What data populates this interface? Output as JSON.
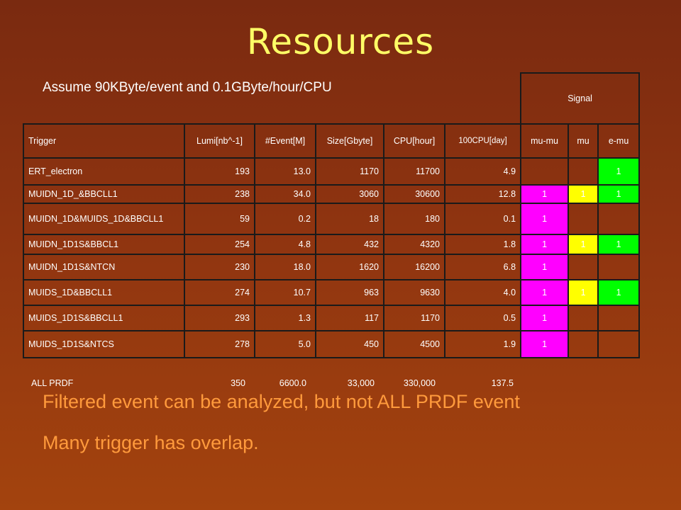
{
  "slide": {
    "title": "Resources",
    "assumption": "Assume 90KByte/event and 0.1GByte/hour/CPU",
    "notes": [
      "Filtered event can be analyzed,  but not ALL PRDF event",
      "Many trigger has overlap."
    ]
  },
  "table": {
    "signal_group_label": "Signal",
    "headers": [
      "Trigger",
      "Lumi[nb^-1]",
      "#Event[M]",
      "Size[Gbyte]",
      "CPU[hour]",
      "100CPU[day]",
      "mu-mu",
      "mu",
      "e-mu"
    ],
    "rows": [
      {
        "trigger": "ERT_electron",
        "lumi": "193",
        "events": "13.0",
        "size": "1170",
        "cpu": "11700",
        "cpu100": "4.9",
        "mumu": "",
        "mu": "",
        "emu": "1"
      },
      {
        "trigger": "MUIDN_1D_&BBCLL1",
        "lumi": "238",
        "events": "34.0",
        "size": "3060",
        "cpu": "30600",
        "cpu100": "12.8",
        "mumu": "1",
        "mu": "1",
        "emu": "1"
      },
      {
        "trigger": "MUIDN_1D&MUIDS_1D&BBCLL1",
        "lumi": "59",
        "events": "0.2",
        "size": "18",
        "cpu": "180",
        "cpu100": "0.1",
        "mumu": "1",
        "mu": "",
        "emu": ""
      },
      {
        "trigger": "MUIDN_1D1S&BBCL1",
        "lumi": "254",
        "events": "4.8",
        "size": "432",
        "cpu": "4320",
        "cpu100": "1.8",
        "mumu": "1",
        "mu": "1",
        "emu": "1"
      },
      {
        "trigger": "MUIDN_1D1S&NTCN",
        "lumi": "230",
        "events": "18.0",
        "size": "1620",
        "cpu": "16200",
        "cpu100": "6.8",
        "mumu": "1",
        "mu": "",
        "emu": ""
      },
      {
        "trigger": "MUIDS_1D&BBCLL1",
        "lumi": "274",
        "events": "10.7",
        "size": "963",
        "cpu": "9630",
        "cpu100": "4.0",
        "mumu": "1",
        "mu": "1",
        "emu": "1"
      },
      {
        "trigger": "MUIDS_1D1S&BBCLL1",
        "lumi": "293",
        "events": "1.3",
        "size": "117",
        "cpu": "1170",
        "cpu100": "0.5",
        "mumu": "1",
        "mu": "",
        "emu": ""
      },
      {
        "trigger": "MUIDS_1D1S&NTCS",
        "lumi": "278",
        "events": "5.0",
        "size": "450",
        "cpu": "4500",
        "cpu100": "1.9",
        "mumu": "1",
        "mu": "",
        "emu": ""
      }
    ],
    "total": {
      "trigger": "ALL PRDF",
      "lumi": "350",
      "events": "6600.0",
      "size": "33,000",
      "cpu": "330,000",
      "cpu100": "137.5"
    },
    "colors": {
      "mumu": "#ff00ff",
      "mu": "#ffff00",
      "emu": "#00ff00"
    }
  }
}
